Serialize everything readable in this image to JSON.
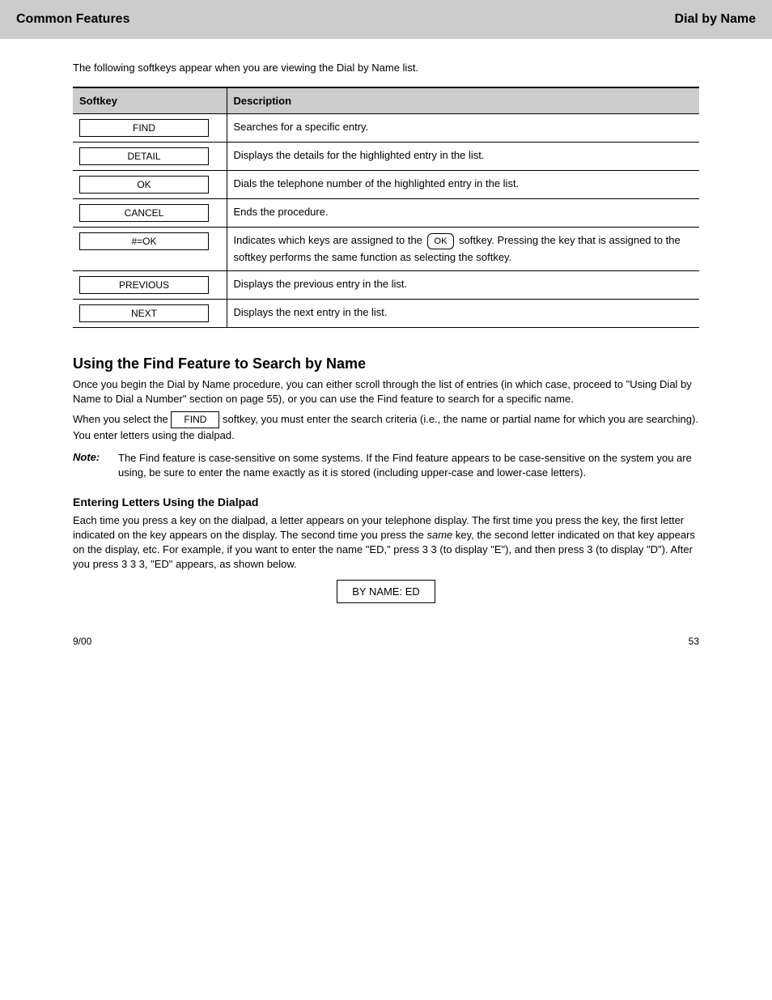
{
  "header": {
    "left": "Common Features",
    "right": "Dial by Name"
  },
  "intro": "The following softkeys appear when you are viewing the Dial by Name list.",
  "table": {
    "th0": "Softkey",
    "th1": "Description",
    "rows": [
      {
        "sk": "FIND",
        "desc": "Searches for a specific entry."
      },
      {
        "sk": "DETAIL",
        "desc": "Displays the details for the highlighted entry in the list."
      },
      {
        "sk": "OK",
        "desc": "Dials the telephone number of the highlighted entry in the list."
      },
      {
        "sk": "CANCEL",
        "desc": "Ends the procedure."
      },
      {
        "sk": "#=OK",
        "desc_parts": {
          "p1": "Indicates which keys are assigned to the ",
          "p2": " softkey. Pressing the key that is assigned to the softkey performs the same function as selecting the softkey."
        }
      },
      {
        "sk": "PREVIOUS",
        "desc": "Displays the previous entry in the list."
      },
      {
        "sk": "NEXT",
        "desc": "Displays the next entry in the list."
      }
    ]
  },
  "ok_key": "OK",
  "s1": {
    "title": "Using the Find Feature to Search by Name",
    "p1": "Once you begin the Dial by Name procedure, you can either scroll through the list of entries (in which case, proceed to \"Using Dial by Name to Dial a Number\" section on page 55), or you can use the Find feature to search for a specific name.",
    "p2_a": "When you select the ",
    "p2_sk": "FIND",
    "p2_b": " softkey, you must enter the search criteria (i.e., the name or partial name for which you are searching). You enter letters using the dialpad.",
    "note_label": "Note:",
    "note_body": "The Find feature is case-sensitive on some systems. If the Find feature appears to be case-sensitive on the system you are using, be sure to enter the name exactly as it is stored (including upper-case and lower-case letters).",
    "sub": "Entering Letters Using the Dialpad",
    "sub_p_a": "Each time you press a key on the dialpad, a letter appears on your telephone display. The first time you press the key, the first letter indicated on the key appears on the display. The second time you press the ",
    "sub_p_b": "same",
    "sub_p_c": " key, the second letter indicated on that key appears on the display, etc. For example, if you want to enter the name \"ED,\" press 3 3 (to display \"E\"), and then press 3 (to display \"D\"). After you press 3 3 3, \"ED\" appears, as shown below.",
    "display": "BY NAME: ED"
  },
  "footer": {
    "left": "9/00",
    "right": "53"
  }
}
